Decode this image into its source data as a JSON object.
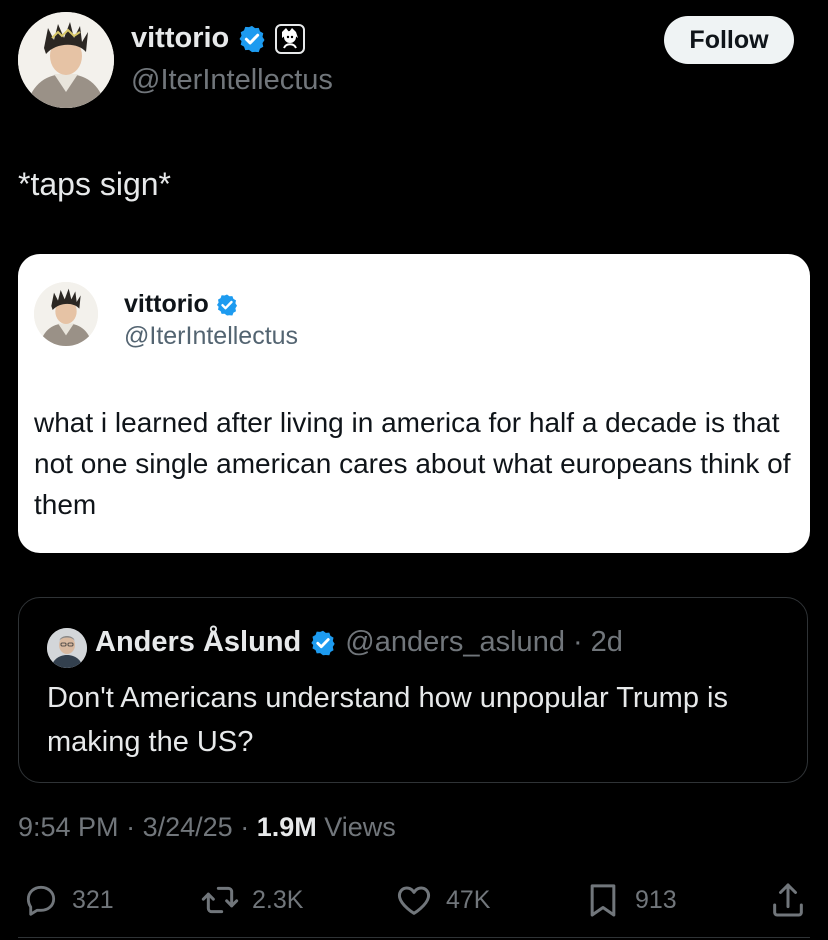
{
  "tweet": {
    "author": {
      "name": "vittorio",
      "handle": "@IterIntellectus",
      "avatar_icon": "anime-avatar",
      "verified_icon": "verified-badge-icon",
      "affiliate_icon": "affiliate-badge-icon"
    },
    "follow_label": "Follow",
    "text": "*taps sign*",
    "screenshot": {
      "name": "vittorio",
      "handle": "@IterIntellectus",
      "text": "what i learned after living in america for half a decade is that not one single american cares about what europeans think of them"
    },
    "quote": {
      "name": "Anders Åslund",
      "handle": "@anders_aslund",
      "separator": "·",
      "age": "2d",
      "text": "Don't Americans understand how unpopular Trump is making the US?"
    },
    "meta": {
      "time": "9:54 PM",
      "sep1": "·",
      "date": "3/24/25",
      "sep2": "·",
      "views_count": "1.9M",
      "views_label": "Views"
    },
    "actions": {
      "replies": "321",
      "reposts": "2.3K",
      "likes": "47K",
      "bookmarks": "913"
    }
  },
  "colors": {
    "background": "#000000",
    "verified_blue": "#1d9bf0",
    "secondary_text": "#71767b"
  }
}
